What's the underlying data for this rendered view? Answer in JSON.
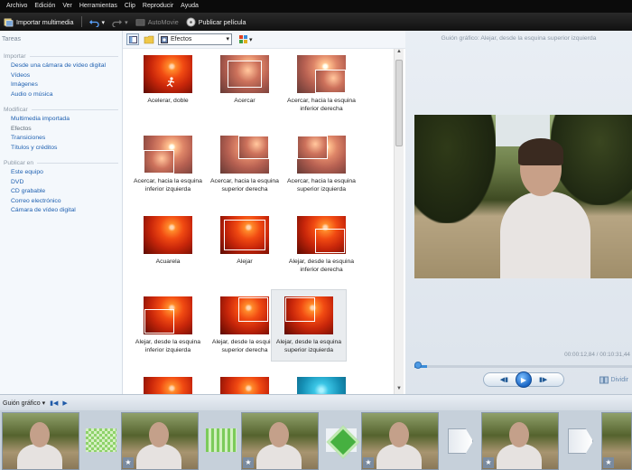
{
  "menu": [
    "Archivo",
    "Edición",
    "Ver",
    "Herramientas",
    "Clip",
    "Reproducir",
    "Ayuda"
  ],
  "toolbar": {
    "import": "Importar multimedia",
    "automovie": "AutoMovie",
    "publish": "Publicar película"
  },
  "tasks": {
    "header": "Tareas",
    "groups": [
      {
        "title": "Importar",
        "items": [
          "Desde una cámara de vídeo digital",
          "Vídeos",
          "Imágenes",
          "Audio o música"
        ]
      },
      {
        "title": "Modificar",
        "items": [
          "Multimedia importada",
          "Efectos",
          "Transiciones",
          "Títulos y créditos"
        ]
      },
      {
        "title": "Publicar en",
        "items": [
          "Este equipo",
          "DVD",
          "CD grabable",
          "Correo electrónico",
          "Cámara de vídeo digital"
        ]
      }
    ]
  },
  "collection": {
    "selected": "Efectos",
    "effects": [
      "Acelerar, doble",
      "Acercar",
      "Acercar, hacia la esquina inferior derecha",
      "Acercar, hacia la esquina inferior izquierda",
      "Acercar, hacia la esquina superior derecha",
      "Acercar, hacia la esquina superior izquierda",
      "Acuarela",
      "Alejar",
      "Alejar, desde la esquina inferior derecha",
      "Alejar, desde la esquina inferior izquierda",
      "Alejar, desde la esquina superior derecha",
      "Alejar, desde la esquina superior izquierda"
    ]
  },
  "preview": {
    "title": "Guión gráfico: Alejar, desde la esquina superior izquierda",
    "timecode": "00:00:12,84 / 00:10:31,44",
    "split": "Dividir"
  },
  "storyboard": {
    "label": "Guión gráfico"
  },
  "colors": {
    "link": "#1d5fb0",
    "menubar": "#0b0b0b",
    "accent": "#3a8cd8"
  }
}
